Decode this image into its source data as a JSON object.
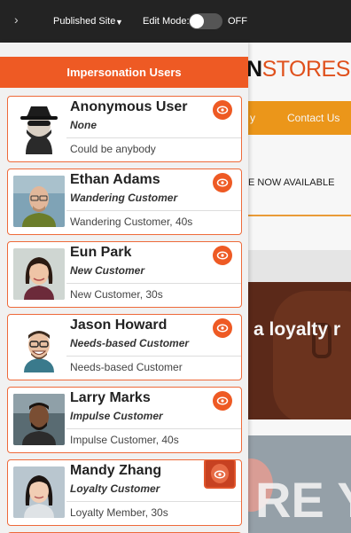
{
  "topbar": {
    "site_selector": "Published Site",
    "edit_mode_label": "Edit Mode:",
    "edit_mode_state": "OFF"
  },
  "site": {
    "logo_left": "N",
    "logo_right": "STORES",
    "nav_left": "y",
    "nav_right": "Contact Us",
    "announcement": "E NOW AVAILABLE",
    "hero_text": "a loyalty r",
    "hero2_text": "RE Y"
  },
  "panel": {
    "title": "Impersonation Users",
    "users": [
      {
        "name": "Anonymous User",
        "persona": "None",
        "description": "Could be anybody"
      },
      {
        "name": "Ethan Adams",
        "persona": "Wandering Customer",
        "description": "Wandering Customer, 40s"
      },
      {
        "name": "Eun Park",
        "persona": "New Customer",
        "description": "New Customer, 30s"
      },
      {
        "name": "Jason Howard",
        "persona": "Needs-based Customer",
        "description": "Needs-based Customer"
      },
      {
        "name": "Larry Marks",
        "persona": "Impulse Customer",
        "description": "Impulse Customer, 40s"
      },
      {
        "name": "Mandy Zhang",
        "persona": "Loyalty Customer",
        "description": "Loyalty Member, 30s"
      }
    ]
  },
  "colors": {
    "accent": "#ee5a24",
    "nav": "#f39b1b",
    "topbar": "#232323"
  },
  "icons": {
    "preview": "eye-icon",
    "expand": "chevron-right-icon",
    "dropdown": "caret-down-icon"
  }
}
